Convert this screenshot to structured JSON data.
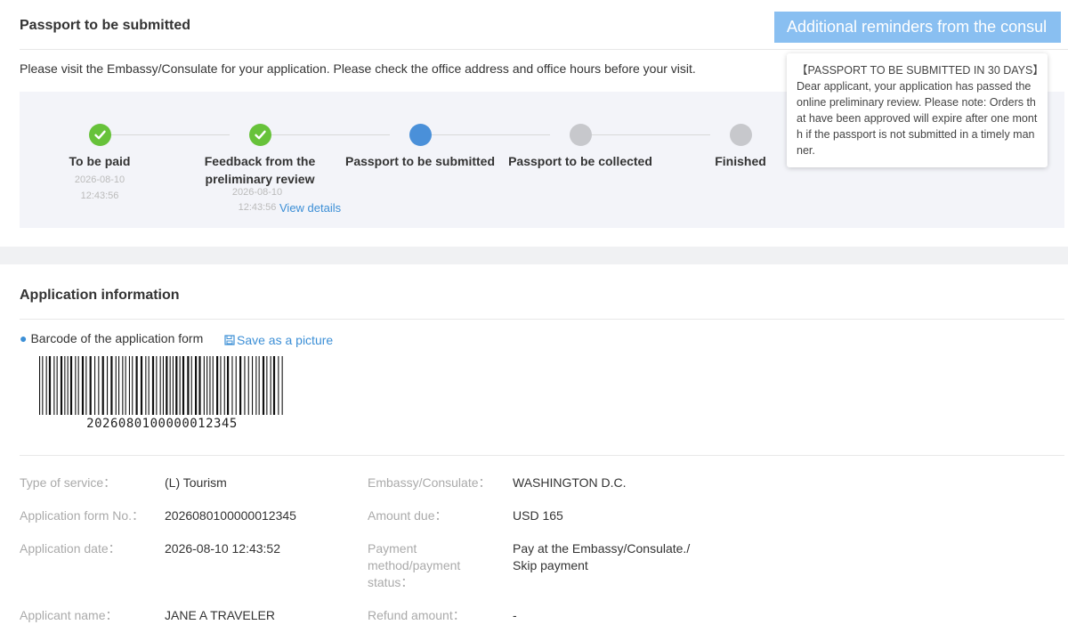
{
  "status_section": {
    "title": "Passport to be submitted",
    "reminder_button": "Additional reminders from the consul",
    "notice": "Please visit the Embassy/Consulate for your application. Please check the office address and office hours before your visit.",
    "steps": [
      {
        "label": "To be paid",
        "time_date": "2026-08-10",
        "time_clock": "12:43:56",
        "state": "done"
      },
      {
        "label": "Feedback from the preliminary review",
        "time_date": "2026-08-10",
        "time_clock": "12:43:56",
        "state": "done"
      },
      {
        "label": "Passport to be submitted",
        "state": "current"
      },
      {
        "label": "Passport to be collected",
        "state": "todo"
      },
      {
        "label": "Finished",
        "state": "todo"
      }
    ],
    "view_details": "View details",
    "tooltip": {
      "text": "【PASSPORT TO BE SUBMITTED IN 30 DAYS】Dear applicant, your application has passed the online preliminary review. Please note: Orders that have been approved will expire after one month if the passport is not submitted in a timely manner."
    }
  },
  "application": {
    "title": "Application information",
    "barcode_label": "Barcode of the application form",
    "save_picture": "Save as a picture",
    "barcode_number": "2026080100000012345",
    "fields": {
      "type_of_service": {
        "label": "Type of service：",
        "value": "(L) Tourism"
      },
      "embassy": {
        "label": "Embassy/Consulate：",
        "value": "WASHINGTON D.C."
      },
      "form_no": {
        "label": "Application form No.：",
        "value": "2026080100000012345"
      },
      "amount_due": {
        "label": "Amount due：",
        "value": "USD 165"
      },
      "app_date": {
        "label": "Application date：",
        "value": "2026-08-10 12:43:52"
      },
      "payment_l1": {
        "label": "Payment",
        "value": "Pay at the Embassy/Consulate./"
      },
      "payment_l2": {
        "label": "method/payment",
        "value": "Skip payment"
      },
      "payment_l3": {
        "label": "status："
      },
      "applicant": {
        "label": "Applicant name：",
        "value": "JANE A TRAVELER"
      },
      "refund": {
        "label": "Refund amount：",
        "value": "-"
      }
    }
  },
  "colors": {
    "done": "#67c23a",
    "current": "#4a90d9",
    "todo": "#c7c8cc",
    "link": "#3c8fd6",
    "button": "#89bff1"
  }
}
